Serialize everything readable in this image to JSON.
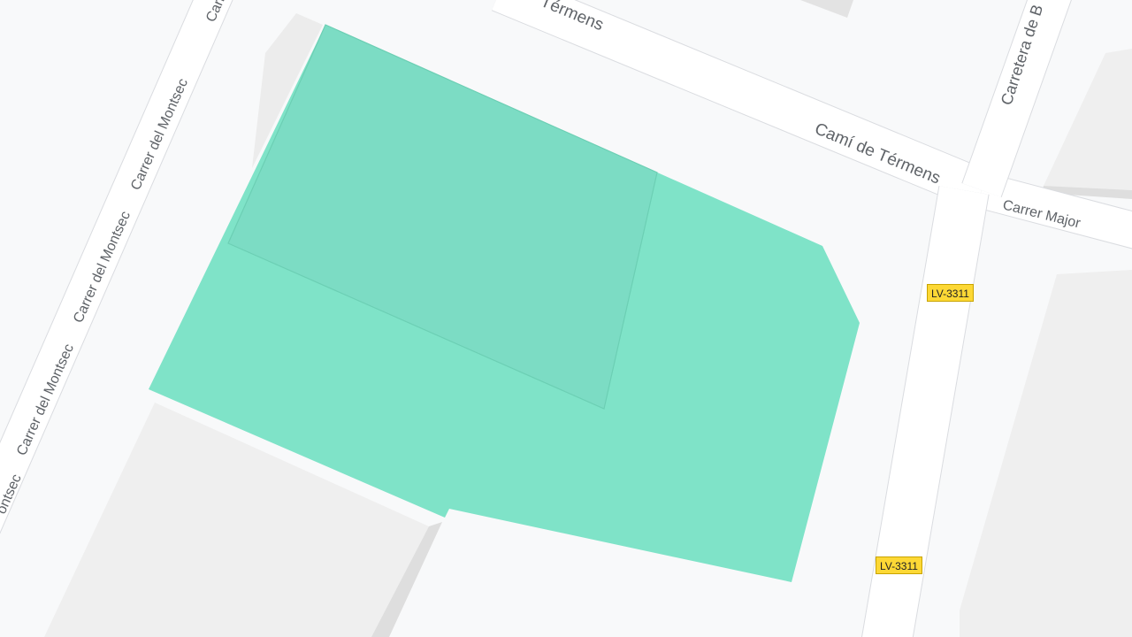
{
  "colors": {
    "background": "#f8f9fa",
    "road": "#ffffff",
    "road_edge": "#dadce0",
    "block": "#efefef",
    "block_shade": "#dedede",
    "highlight": "#7fe3c8",
    "highlight_edge": "#6ccfb4",
    "label": "#5f6368",
    "route_badge": "#fdd835"
  },
  "streets": {
    "carrer_montsec": "Carrer del Montsec",
    "carrer_montsec_top": "Carre",
    "carrer_montsec_bottom": "ontsec",
    "cami_termens": "Camí de Térmens",
    "cami_termens_top": "Térmens",
    "carrer_major": "Carrer Major",
    "carretera_top": "Carretera de B"
  },
  "routes": {
    "top": "LV-3311",
    "bottom": "LV-3311"
  }
}
